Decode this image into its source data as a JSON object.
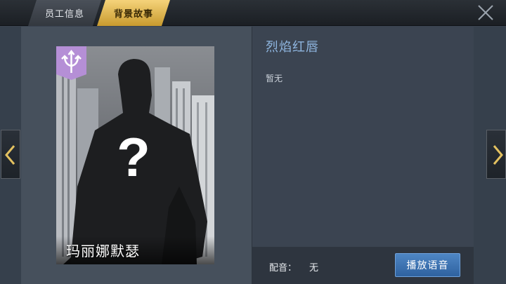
{
  "tabs": [
    {
      "label": "员工信息",
      "active": false
    },
    {
      "label": "背景故事",
      "active": true
    }
  ],
  "card": {
    "name": "玛丽娜默瑟",
    "mystery_symbol": "?",
    "rank_badge_icon": "rank-badge-icon",
    "emblem_icon": "trident-emblem-icon"
  },
  "story": {
    "title": "烈焰红唇",
    "body": "暂无"
  },
  "voice": {
    "label": "配音：",
    "value": "无",
    "play_label": "播放语音"
  },
  "colors": {
    "active_tab": "#e8b94a",
    "title": "#8fb6e0",
    "play_button": "#3a72b3",
    "emblem": "#b58fd6"
  }
}
